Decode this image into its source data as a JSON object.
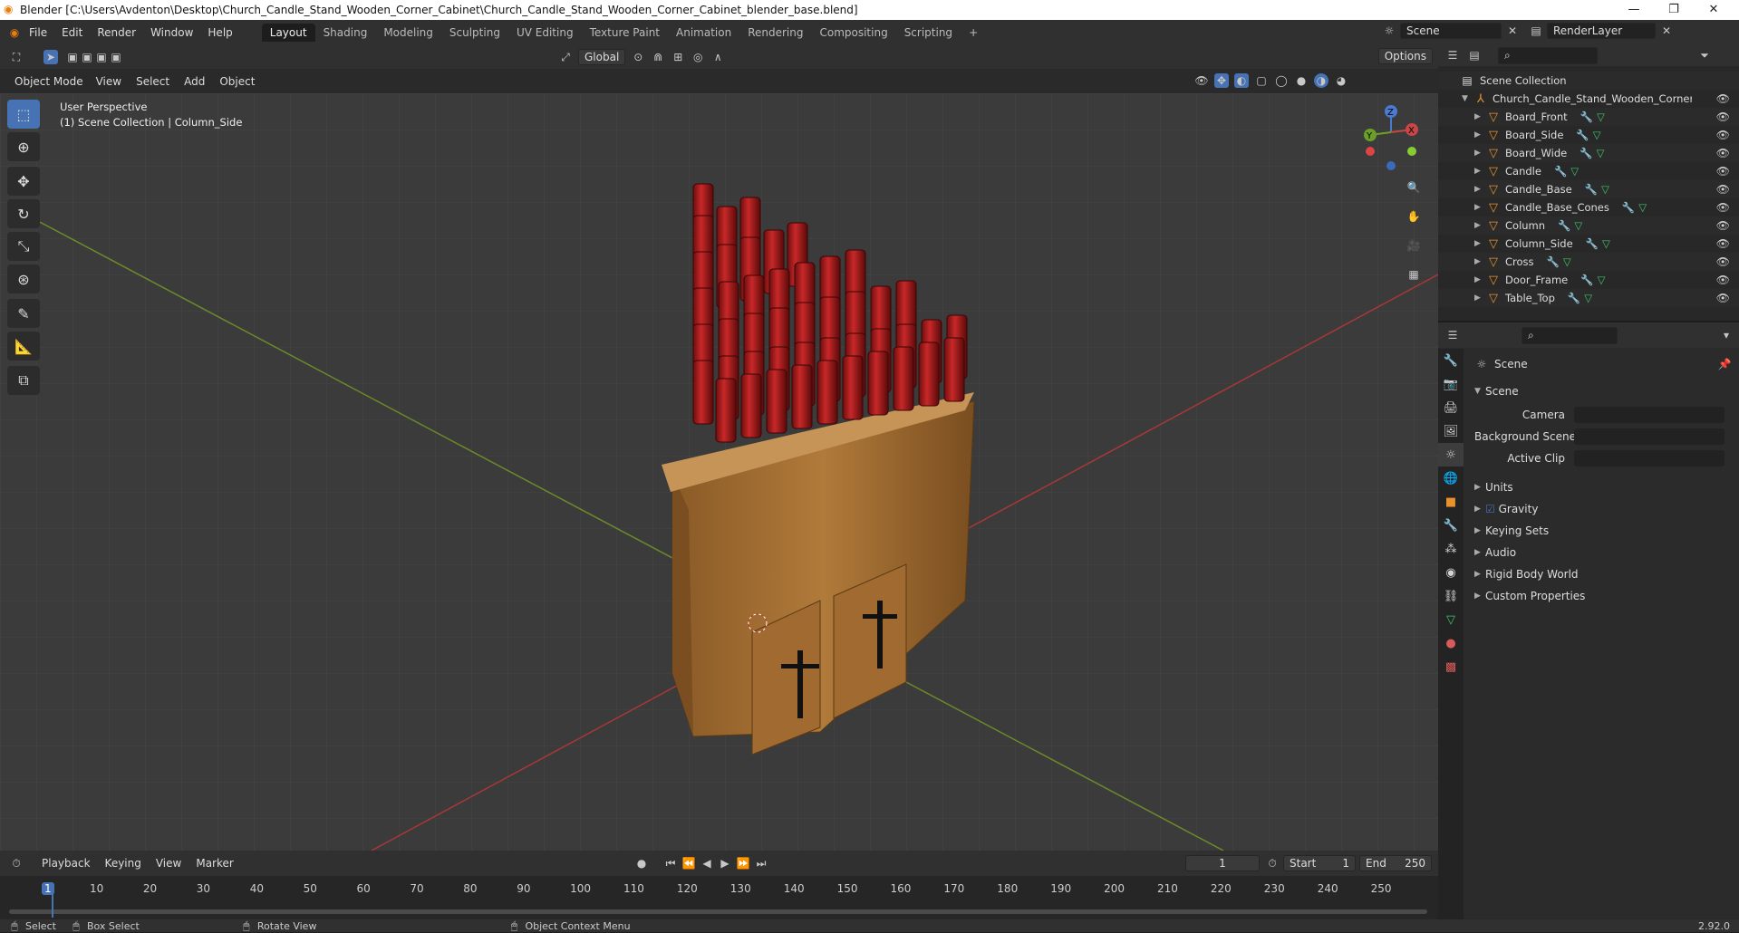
{
  "window": {
    "title": "Blender [C:\\Users\\Avdenton\\Desktop\\Church_Candle_Stand_Wooden_Corner_Cabinet\\Church_Candle_Stand_Wooden_Corner_Cabinet_blender_base.blend]"
  },
  "menu": [
    "File",
    "Edit",
    "Render",
    "Window",
    "Help"
  ],
  "workspaces": [
    "Layout",
    "Shading",
    "Modeling",
    "Sculpting",
    "UV Editing",
    "Texture Paint",
    "Animation",
    "Rendering",
    "Compositing",
    "Scripting"
  ],
  "scene": {
    "name": "Scene",
    "view_layer": "RenderLayer"
  },
  "viewport_header": {
    "transform": "Global",
    "options": "Options",
    "mode": "Object Mode",
    "menus": [
      "View",
      "Select",
      "Add",
      "Object"
    ]
  },
  "viewport": {
    "perspective": "User Perspective",
    "context": "(1) Scene Collection | Column_Side"
  },
  "outliner": {
    "root": "Scene Collection",
    "collection": "Church_Candle_Stand_Wooden_Corner_Cabi",
    "objects": [
      "Board_Front",
      "Board_Side",
      "Board_Wide",
      "Candle",
      "Candle_Base",
      "Candle_Base_Cones",
      "Column",
      "Column_Side",
      "Cross",
      "Door_Frame",
      "Table_Top"
    ]
  },
  "properties": {
    "header": "Scene",
    "section": "Scene",
    "fields": [
      {
        "label": "Camera"
      },
      {
        "label": "Background Scene"
      },
      {
        "label": "Active Clip"
      }
    ],
    "panels": [
      "Units",
      "Gravity",
      "Keying Sets",
      "Audio",
      "Rigid Body World",
      "Custom Properties"
    ]
  },
  "timeline": {
    "menus": [
      "Playback",
      "Keying",
      "View",
      "Marker"
    ],
    "current": "1",
    "start_label": "Start",
    "start": "1",
    "end_label": "End",
    "end": "250",
    "ticks": [
      "1",
      "10",
      "20",
      "30",
      "40",
      "50",
      "60",
      "70",
      "80",
      "90",
      "100",
      "110",
      "120",
      "130",
      "140",
      "150",
      "160",
      "170",
      "180",
      "190",
      "200",
      "210",
      "220",
      "230",
      "240",
      "250"
    ]
  },
  "status": {
    "select": "Select",
    "box": "Box Select",
    "rotate": "Rotate View",
    "context": "Object Context Menu",
    "version": "2.92.0"
  },
  "colors": {
    "accent": "#4772b3",
    "mesh_icon": "#e8922d",
    "wood": "#b07a3a",
    "candle": "#b01e1e"
  }
}
